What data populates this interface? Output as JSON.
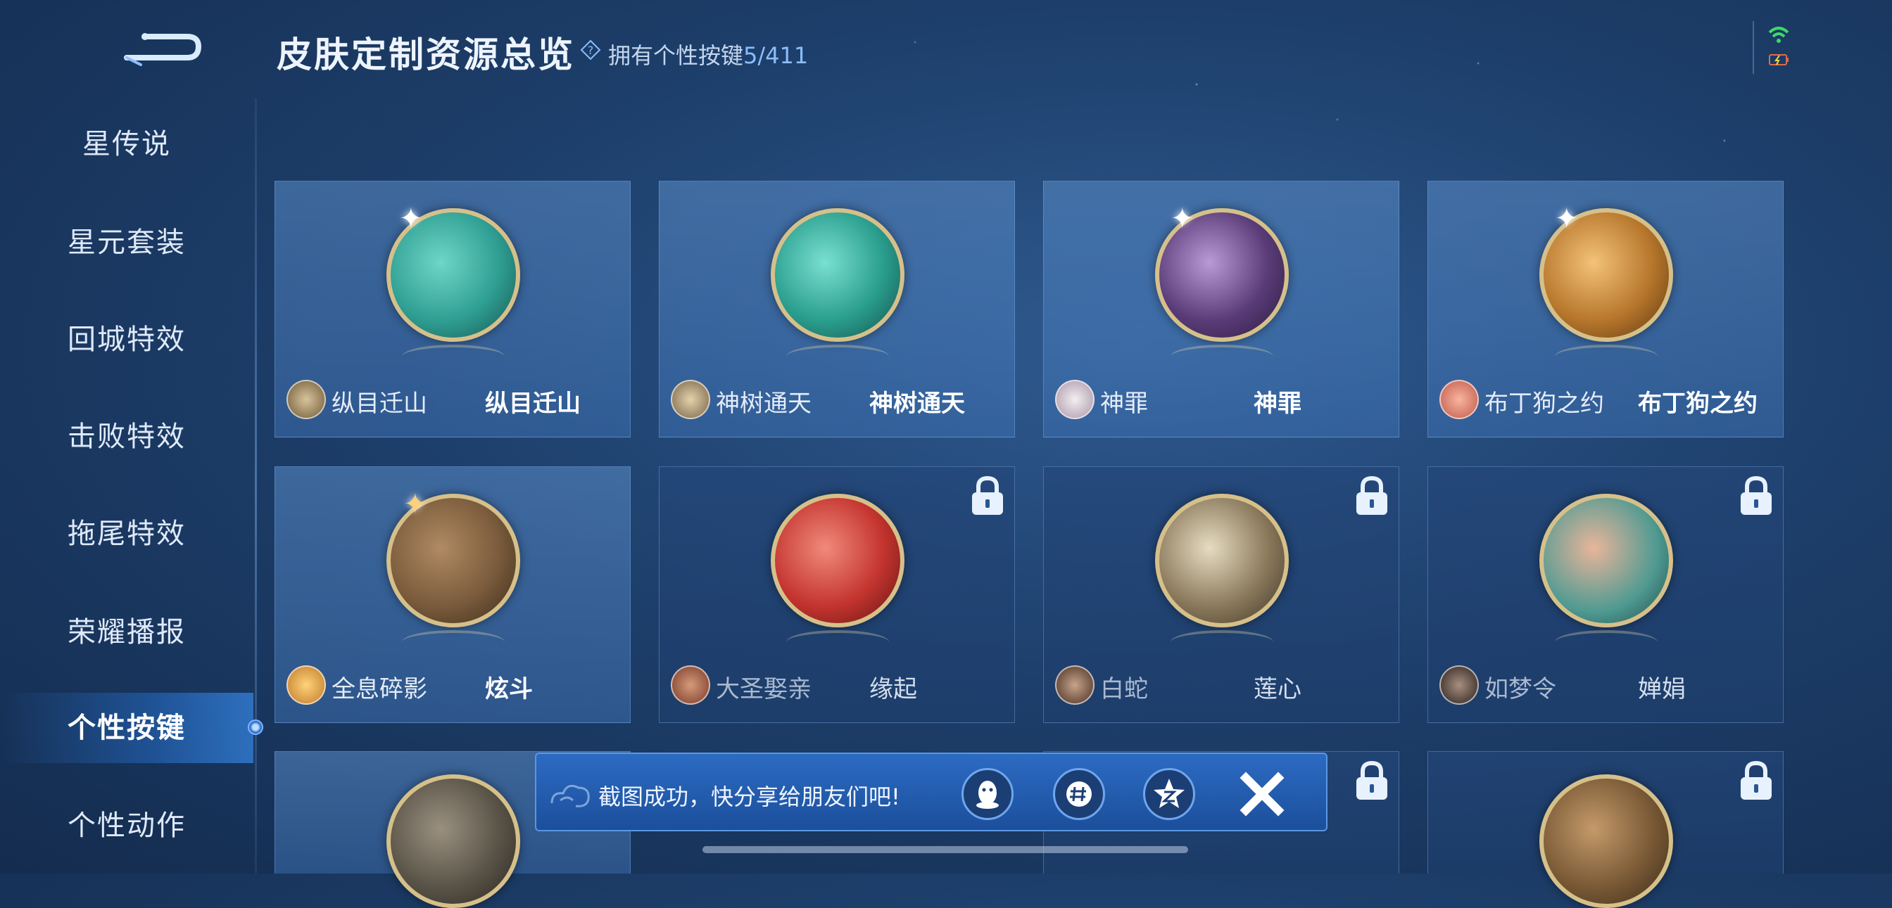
{
  "header": {
    "title": "皮肤定制资源总览",
    "owned_label": "拥有个性按键",
    "owned_value": "5/411"
  },
  "sidebar": {
    "items": [
      {
        "label": "星传说"
      },
      {
        "label": "星元套装"
      },
      {
        "label": "回城特效"
      },
      {
        "label": "击败特效"
      },
      {
        "label": "拖尾特效"
      },
      {
        "label": "荣耀播报"
      },
      {
        "label": "个性按键"
      },
      {
        "label": "个性动作"
      }
    ],
    "active": "个性按键"
  },
  "cards": [
    {
      "hero": "纵目迁山",
      "skin": "纵目迁山",
      "locked": false,
      "orb_color": "#2f9f93"
    },
    {
      "hero": "神树通天",
      "skin": "神树通天",
      "locked": false,
      "orb_color": "#2a9e8e"
    },
    {
      "hero": "神罪",
      "skin": "神罪",
      "locked": false,
      "orb_color": "#5a3c78"
    },
    {
      "hero": "布丁狗之约",
      "skin": "布丁狗之约",
      "locked": false,
      "orb_color": "#b7772c"
    },
    {
      "hero": "全息碎影",
      "skin": "炫斗",
      "locked": false,
      "orb_color": "#7a5b3c"
    },
    {
      "hero": "大圣娶亲",
      "skin": "缘起",
      "locked": true,
      "orb_color": "#c4342f"
    },
    {
      "hero": "白蛇",
      "skin": "莲心",
      "locked": true,
      "orb_color": "#8b7a5c"
    },
    {
      "hero": "如梦令",
      "skin": "婵娟",
      "locked": true,
      "orb_color": "#4f9a92"
    }
  ],
  "toast": {
    "message": "截图成功，快分享给朋友们吧!",
    "share_targets": [
      "qq-icon",
      "wechat-moments-icon",
      "qzone-icon"
    ]
  },
  "colors": {
    "accent": "#8cbdfa",
    "toast_bg": "#2c6bc2",
    "card_bg": "#5a8cc8"
  }
}
